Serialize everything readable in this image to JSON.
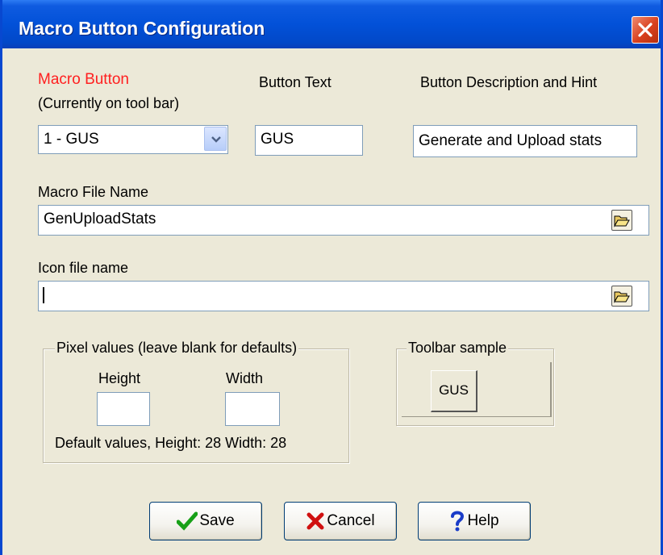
{
  "window": {
    "title": "Macro Button Configuration"
  },
  "macro_button": {
    "label": "Macro Button",
    "sublabel": "(Currently on tool bar)",
    "selected": "1 - GUS"
  },
  "button_text": {
    "label": "Button Text",
    "value": "GUS"
  },
  "description": {
    "label": "Button Description and Hint",
    "value": "Generate and Upload stats"
  },
  "macro_file": {
    "label": "Macro File Name",
    "value": "GenUploadStats"
  },
  "icon_file": {
    "label": "Icon file name",
    "value": ""
  },
  "pixel_group": {
    "title": "Pixel values (leave blank for defaults)",
    "height_label": "Height",
    "width_label": "Width",
    "height_value": "",
    "width_value": "",
    "defaults_text": "Default values, Height: 28 Width: 28"
  },
  "toolbar_sample": {
    "title": "Toolbar sample",
    "button_label": "GUS"
  },
  "buttons": {
    "save": "Save",
    "cancel": "Cancel",
    "help": "Help"
  },
  "colors": {
    "title_bar": "#0251d8",
    "dialog_bg": "#ece9d8",
    "accent_label": "#ff2020",
    "close": "#d8401e"
  },
  "icons": [
    "close-icon",
    "dropdown-arrow-icon",
    "folder-open-icon",
    "checkmark-icon",
    "x-cancel-icon",
    "question-icon"
  ]
}
